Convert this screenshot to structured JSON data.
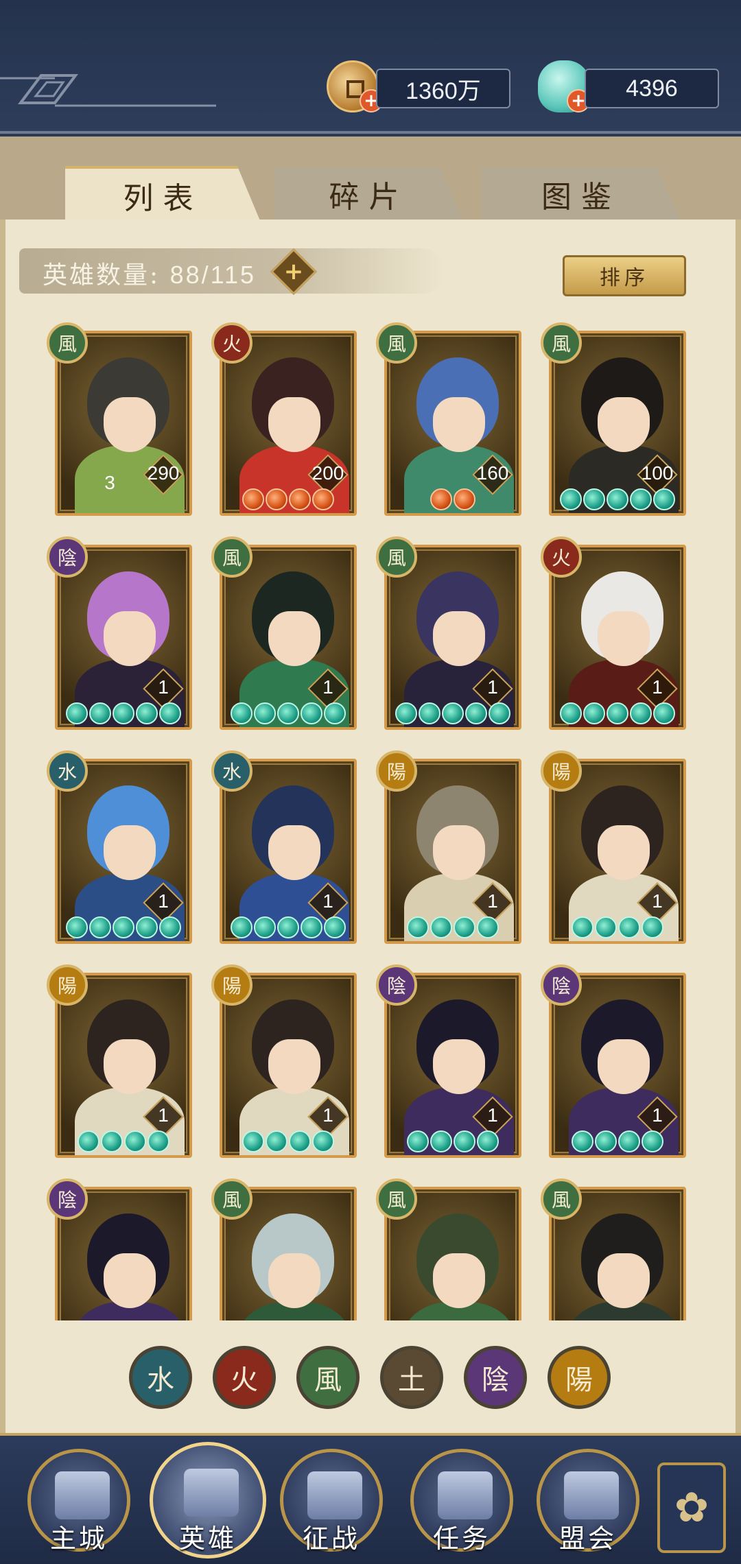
{
  "resources": {
    "copper": {
      "value": "1360万",
      "icon": "copper-coin-icon"
    },
    "jade": {
      "value": "4396",
      "icon": "jade-shell-icon"
    }
  },
  "tabs": [
    {
      "label": "列表",
      "active": true
    },
    {
      "label": "碎片",
      "active": false
    },
    {
      "label": "图鉴",
      "active": false
    }
  ],
  "hero_count": {
    "label": "英雄数量:",
    "value": "88/115"
  },
  "sort_button": "排序",
  "elements": {
    "wind": {
      "glyph": "風",
      "color": "#3f6f40"
    },
    "fire": {
      "glyph": "火",
      "color": "#8a2a1c"
    },
    "water": {
      "glyph": "水",
      "color": "#285f68"
    },
    "yin": {
      "glyph": "陰",
      "color": "#5b3778"
    },
    "yang": {
      "glyph": "陽",
      "color": "#b57c12"
    },
    "earth": {
      "glyph": "土",
      "color": "#5a4a33"
    }
  },
  "heroes": [
    {
      "element": "wind",
      "level": "290",
      "stars": 0,
      "star_color": "",
      "star_number": "3",
      "hair": "#3b3a34",
      "outfit": "#86a84c"
    },
    {
      "element": "fire",
      "level": "200",
      "stars": 4,
      "star_color": "red",
      "star_number": "",
      "hair": "#3a2220",
      "outfit": "#c8342a"
    },
    {
      "element": "wind",
      "level": "160",
      "stars": 2,
      "star_color": "red",
      "star_number": "",
      "hair": "#4a6fb5",
      "outfit": "#3e8a6a"
    },
    {
      "element": "wind",
      "level": "100",
      "stars": 5,
      "star_color": "green",
      "star_number": "",
      "hair": "#1e1a18",
      "outfit": "#2c2a24"
    },
    {
      "element": "yin",
      "level": "1",
      "stars": 5,
      "star_color": "green",
      "star_number": "",
      "hair": "#b676c9",
      "outfit": "#2b2238"
    },
    {
      "element": "wind",
      "level": "1",
      "stars": 5,
      "star_color": "green",
      "star_number": "",
      "hair": "#1d2722",
      "outfit": "#2f7a4e"
    },
    {
      "element": "wind",
      "level": "1",
      "stars": 5,
      "star_color": "green",
      "star_number": "",
      "hair": "#3a3560",
      "outfit": "#28223a"
    },
    {
      "element": "fire",
      "level": "1",
      "stars": 5,
      "star_color": "green",
      "star_number": "",
      "hair": "#e9e8e4",
      "outfit": "#5a1c16"
    },
    {
      "element": "water",
      "level": "1",
      "stars": 5,
      "star_color": "green",
      "star_number": "",
      "hair": "#4f8fd8",
      "outfit": "#2b4e86"
    },
    {
      "element": "water",
      "level": "1",
      "stars": 5,
      "star_color": "green",
      "star_number": "",
      "hair": "#23335a",
      "outfit": "#2f4f94"
    },
    {
      "element": "yang",
      "level": "1",
      "stars": 4,
      "star_color": "green",
      "star_number": "",
      "hair": "#8d8570",
      "outfit": "#d9cfb0"
    },
    {
      "element": "yang",
      "level": "1",
      "stars": 4,
      "star_color": "green",
      "star_number": "",
      "hair": "#2d2420",
      "outfit": "#e0d9c0"
    },
    {
      "element": "yang",
      "level": "1",
      "stars": 4,
      "star_color": "green",
      "star_number": "",
      "hair": "#2d2420",
      "outfit": "#e0d9c0"
    },
    {
      "element": "yang",
      "level": "1",
      "stars": 4,
      "star_color": "green",
      "star_number": "",
      "hair": "#2d2420",
      "outfit": "#e0d9c0"
    },
    {
      "element": "yin",
      "level": "1",
      "stars": 4,
      "star_color": "green",
      "star_number": "",
      "hair": "#1c1a2a",
      "outfit": "#3e2c5e"
    },
    {
      "element": "yin",
      "level": "1",
      "stars": 4,
      "star_color": "green",
      "star_number": "",
      "hair": "#1c1a2a",
      "outfit": "#3e2c5e"
    },
    {
      "element": "yin",
      "level": "",
      "stars": 0,
      "star_color": "",
      "star_number": "",
      "hair": "#1c1a2a",
      "outfit": "#3e2c5e"
    },
    {
      "element": "wind",
      "level": "",
      "stars": 0,
      "star_color": "",
      "star_number": "",
      "hair": "#b8c8c8",
      "outfit": "#2f5a3a"
    },
    {
      "element": "wind",
      "level": "",
      "stars": 0,
      "star_color": "",
      "star_number": "",
      "hair": "#3a4a2e",
      "outfit": "#3a6a3e"
    },
    {
      "element": "wind",
      "level": "",
      "stars": 0,
      "star_color": "",
      "star_number": "",
      "hair": "#1f1e1c",
      "outfit": "#2c3a30"
    }
  ],
  "filters": [
    "water",
    "fire",
    "wind",
    "earth",
    "yin",
    "yang"
  ],
  "nav": [
    {
      "label": "主城",
      "icon": "castle-icon",
      "active": false
    },
    {
      "label": "英雄",
      "icon": "hero-portrait-icon",
      "active": true
    },
    {
      "label": "征战",
      "icon": "battle-icon",
      "active": false
    },
    {
      "label": "任务",
      "icon": "task-scroll-icon",
      "active": false
    },
    {
      "label": "盟会",
      "icon": "alliance-gate-icon",
      "active": false
    }
  ],
  "nav_more_icon": "more-menu-icon"
}
